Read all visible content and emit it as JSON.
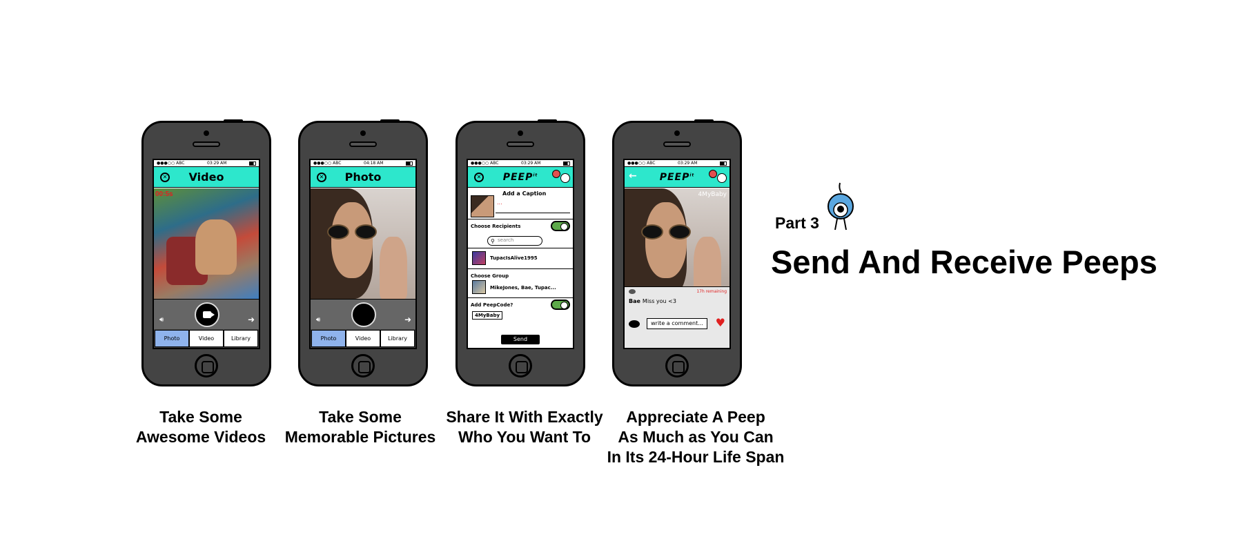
{
  "phones": [
    {
      "status": {
        "carrier": "●●●○○ ABC",
        "time": "03:29 AM"
      },
      "title": "Video",
      "timer": "00:5s",
      "tabs": [
        "Photo",
        "Video",
        "Library"
      ],
      "active_tab": "Photo"
    },
    {
      "status": {
        "carrier": "●●●○○ ABC",
        "time": "04:18 AM"
      },
      "title": "Photo",
      "tabs": [
        "Photo",
        "Video",
        "Library"
      ],
      "active_tab": "Photo"
    },
    {
      "status": {
        "carrier": "●●●○○ ABC",
        "time": "03:29 AM"
      },
      "logo": "PEEP",
      "logo_sup": "it",
      "add_caption": "Add a Caption",
      "caption_value": "...",
      "choose_recipients": "Choose Recipients",
      "search_placeholder": "search",
      "recipient": "TupacIsAlive1995",
      "choose_group": "Choose Group",
      "group_members": "MikeJones, Bae, Tupac...",
      "add_peepcode": "Add PeepCode?",
      "peepcode": "4MyBaby",
      "send": "Send"
    },
    {
      "status": {
        "carrier": "●●●○○ ABC",
        "time": "03:29 AM"
      },
      "logo": "PEEP",
      "logo_sup": "it",
      "photo_tag": "4MyBaby",
      "remaining": "17h remaining",
      "commenter": "Bae",
      "comment": "Miss you <3",
      "comment_placeholder": "write a comment..."
    }
  ],
  "captions": [
    "Take Some\nAwesome Videos",
    "Take Some\nMemorable Pictures",
    "Share It With Exactly\nWho You Want To",
    "Appreciate A Peep\nAs Much as You Can\nIn Its 24-Hour Life Span"
  ],
  "part_label": "Part 3",
  "headline": "Send And Receive Peeps",
  "colors": {
    "accent": "#2de7cc",
    "active_tab": "#8fb3ec",
    "toggle_on": "#5daa4a",
    "alert": "#e02020",
    "phone_body": "#444444"
  }
}
